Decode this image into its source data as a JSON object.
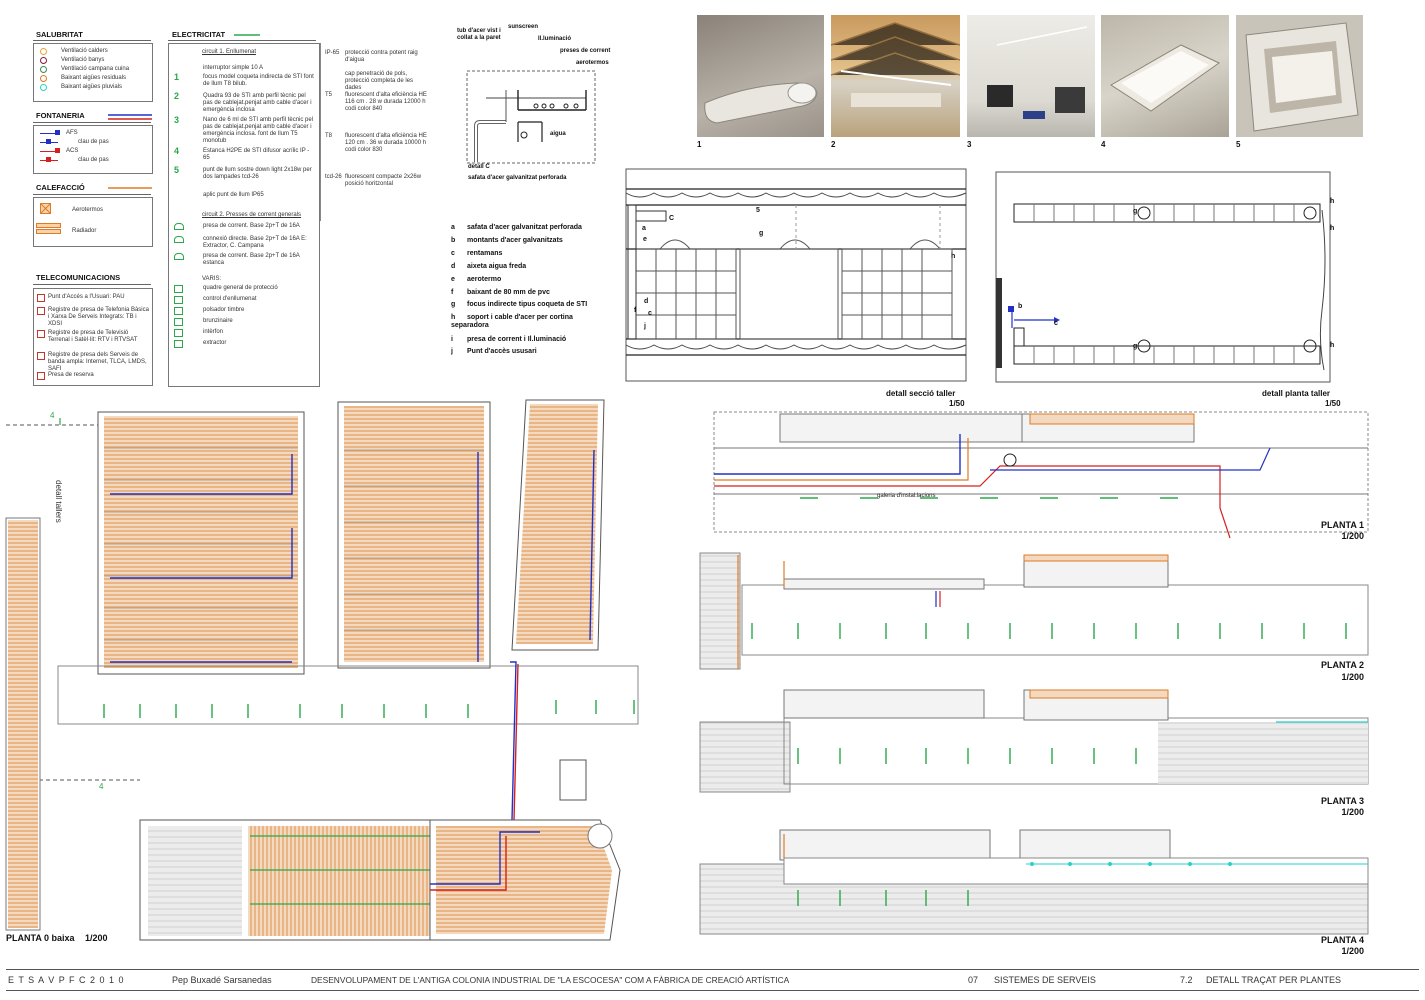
{
  "legend": {
    "salubritat": {
      "title": "SALUBRITAT",
      "items": [
        {
          "label": "Ventilació calders",
          "color": "#e8a33c"
        },
        {
          "label": "Ventilació banys",
          "color": "#8a1b3a"
        },
        {
          "label": "Ventilació campana cuina",
          "color": "#3a8a5a"
        },
        {
          "label": "Baixant aigües residuals",
          "color": "#e07a24"
        },
        {
          "label": "Baixant aigües pluvials",
          "color": "#2ad1c8"
        }
      ]
    },
    "fontaneria": {
      "title": "FONTANERIA",
      "items": [
        {
          "label": "AFS",
          "color": "#2230c8"
        },
        {
          "label": "clau de pas",
          "color": "#2230c8"
        },
        {
          "label": "ACS",
          "color": "#d42020"
        },
        {
          "label": "clau de pas",
          "color": "#d42020"
        }
      ]
    },
    "calefaccio": {
      "title": "CALEFACCIÓ",
      "items": [
        {
          "label": "Aerotermos"
        },
        {
          "label": "Radiador"
        }
      ]
    },
    "telecomunicacions": {
      "title": "TELECOMUNICACIONS",
      "items": [
        {
          "label": "Punt d'Accés a l'Usuari: PAU"
        },
        {
          "label": "Registre de presa de Telefonia Bàsica i Xarxa De Serveis Integrats: TB i XDSI"
        },
        {
          "label": "Registre de presa de Televisió Terrenal i Satèl·lit: RTV i RTVSAT"
        },
        {
          "label": "Registre de presa dels Serveis de banda ampla: Internet, TLCA, LMDS, SAFI"
        },
        {
          "label": "Presa de reserva"
        }
      ]
    },
    "electricitat": {
      "title": "ELECTRICITAT",
      "circuit1": "circuit 1. Enllumenat",
      "items": [
        {
          "sym": "",
          "label": "interruptor simple 10 A"
        },
        {
          "sym": "1",
          "label": "focus model coqueta indirecta de STI font de llum T8 bilub."
        },
        {
          "sym": "2",
          "label": "Quadra 93 de STI amb perfil tècnic pel pas de cablejat.penjat amb cable d'acer i emergència inclosa"
        },
        {
          "sym": "3",
          "label": "Nano de 6 ml de STI amb perfil tècnic pel pas de cablejat.penjat amb cable d'acer i emergència inclosa. font de llum T5 monotub"
        },
        {
          "sym": "4",
          "label": "Estanca H2PE de STI difusor acrílic IP - 65"
        },
        {
          "sym": "5",
          "label": "punt de llum sostre down light 2x18w per dos lampades tcd-26"
        },
        {
          "sym": "",
          "label": "aplic punt de llum IP65"
        }
      ],
      "circuit2": "circuit 2. Presses de corrent generals",
      "items2": [
        {
          "label": "presa de corrent. Base 2p+T de 16A"
        },
        {
          "label": "connexió directe. Base 2p+T de 16A E: Extractor, C. Campana"
        },
        {
          "label": "presa de corrent. Base 2p+T de 16A estanca"
        }
      ],
      "varis": "VARIS:",
      "items3": [
        {
          "label": "quadre general de protecció"
        },
        {
          "label": "control d'enllumenat"
        },
        {
          "label": "polsador timbre"
        },
        {
          "label": "brunzinaire"
        },
        {
          "label": "intèrfon"
        },
        {
          "label": "extractor"
        }
      ],
      "specs": [
        {
          "code": "IP-65",
          "text": "protecció contra potent raig d'aigua"
        },
        {
          "code": "",
          "text": "cap penetració de pols, protecció completa de les dades"
        },
        {
          "code": "T5",
          "text": "fluorescent d'alta eficiència HE 116 cm . 28 w durada 12000 h codi color 840"
        },
        {
          "code": "T8",
          "text": "fluorescent d'alta eficiència HE 120 cm . 36 w durada 10000 h codi color 830"
        },
        {
          "code": "tcd-26",
          "text": "fluorescent compacte 2x26w posició horitzontal"
        }
      ]
    }
  },
  "detail_c": {
    "labels": {
      "tub": "tub d'acer vist i collat a la paret",
      "sunscreen": "sunscreen",
      "illuminacio": "Il.luminació",
      "preses": "preses de corrent",
      "aerotermos": "aerotermos",
      "aigua": "aigua"
    },
    "title": "detall C",
    "subtitle": "safata d'acer galvanitzat perforada"
  },
  "key": [
    {
      "k": "a",
      "v": "safata d'acer galvanitzat perforada"
    },
    {
      "k": "b",
      "v": "montants d'acer galvanitzats"
    },
    {
      "k": "c",
      "v": "rentamans"
    },
    {
      "k": "d",
      "v": "aixeta aigua freda"
    },
    {
      "k": "e",
      "v": "aerotermo"
    },
    {
      "k": "f",
      "v": "baixant de 80 mm de pvc"
    },
    {
      "k": "g",
      "v": "focus indirecte tipus coqueta de STI"
    },
    {
      "k": "h",
      "v": "soport i cable d'acer per cortina separadora"
    },
    {
      "k": "i",
      "v": "presa de corrent i Il.luminació"
    },
    {
      "k": "j",
      "v": "Punt d'accès ususari"
    }
  ],
  "photos": [
    "1",
    "2",
    "3",
    "4",
    "5"
  ],
  "details": {
    "seccio": {
      "title": "detall secció taller",
      "scale": "1/50"
    },
    "planta": {
      "title": "detall planta taller",
      "scale": "1/50"
    }
  },
  "plans": {
    "planta0": {
      "title": "PLANTA 0 baixa",
      "scale": "1/200",
      "detall": "detall tallers",
      "marker4a": "4",
      "marker4b": "4",
      "galeria": "galeria d'instal.lacions"
    },
    "planta1": {
      "title": "PLANTA 1",
      "scale": "1/200"
    },
    "planta2": {
      "title": "PLANTA 2",
      "scale": "1/200"
    },
    "planta3": {
      "title": "PLANTA 3",
      "scale": "1/200"
    },
    "planta4": {
      "title": "PLANTA 4",
      "scale": "1/200"
    }
  },
  "footer": {
    "school": "E T S A V   P F C  2 0 1 0",
    "author": "Pep Buxadé Sarsanedas",
    "project": "DESENVOLUPAMENT DE L'ANTIGA COLONIA INDUSTRIAL DE \"LA ESCOCESA\" COM A FÀBRICA DE CREACIÓ ARTÍSTICA",
    "num": "07",
    "section": "SISTEMES DE SERVEIS",
    "sheet": "7.2",
    "sheet_title": "DETALL TRAÇAT PER PLANTES"
  }
}
